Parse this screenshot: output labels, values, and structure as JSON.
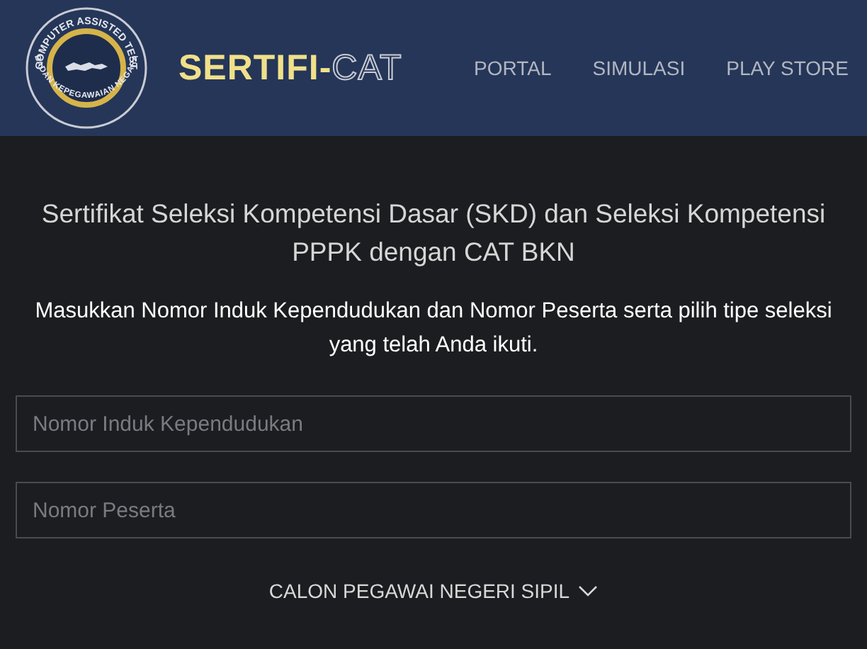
{
  "header": {
    "emblem": {
      "top_text": "COMPUTER ASSISTED TEST",
      "bottom_text": "BADAN KEPEGAWAIAN NEGARA"
    },
    "brand": {
      "solid": "SERTIFI-",
      "outline": "CAT"
    },
    "nav": [
      {
        "label": "PORTAL"
      },
      {
        "label": "SIMULASI"
      },
      {
        "label": "PLAY STORE"
      }
    ]
  },
  "main": {
    "title": "Sertifikat Seleksi Kompetensi Dasar (SKD) dan Seleksi Kompetensi PPPK dengan CAT BKN",
    "instruction": "Masukkan Nomor Induk Kependudukan dan Nomor Peserta serta pilih tipe seleksi yang telah Anda ikuti.",
    "fields": [
      {
        "placeholder": "Nomor Induk Kependudukan"
      },
      {
        "placeholder": "Nomor Peserta"
      }
    ],
    "selection_type": {
      "value": "CALON PEGAWAI NEGERI SIPIL"
    }
  }
}
